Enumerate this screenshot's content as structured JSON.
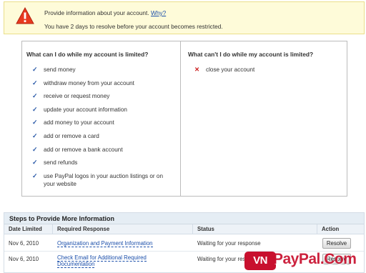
{
  "alert": {
    "icon": "warning-triangle-icon",
    "line1_text": "Provide information about your account.",
    "line1_link": "Why?",
    "line2_text": "You have 2 days to resolve before your account becomes restricted."
  },
  "limits": {
    "can_heading": "What can I do while my account is limited?",
    "can_items": [
      "send money",
      "withdraw money from your account",
      "receive or request money",
      "update your account information",
      "add money to your account",
      "add or remove a card",
      "add or remove a bank account",
      "send refunds",
      "use PayPal logos in your auction listings or on your website"
    ],
    "cannot_heading": "What can't I do while my account is limited?",
    "cannot_items": [
      "close your account"
    ],
    "check_icon": "checkmark-icon",
    "cross_icon": "x-icon"
  },
  "steps": {
    "title": "Steps to Provide More Information",
    "columns": [
      "Date Limited",
      "Required Response",
      "Status",
      "Action"
    ],
    "rows": [
      {
        "date": "Nov 6, 2010",
        "response": "Organization and Payment Information",
        "status": "Waiting for your response",
        "action": "Resolve"
      },
      {
        "date": "Nov 6, 2010",
        "response": "Check Email for Additional Required Documentation",
        "status": "Waiting for your response",
        "action": "Resolve"
      }
    ]
  },
  "watermark": {
    "badge": "VN",
    "text": "PayPal.Com",
    "color": "#c8102e"
  }
}
